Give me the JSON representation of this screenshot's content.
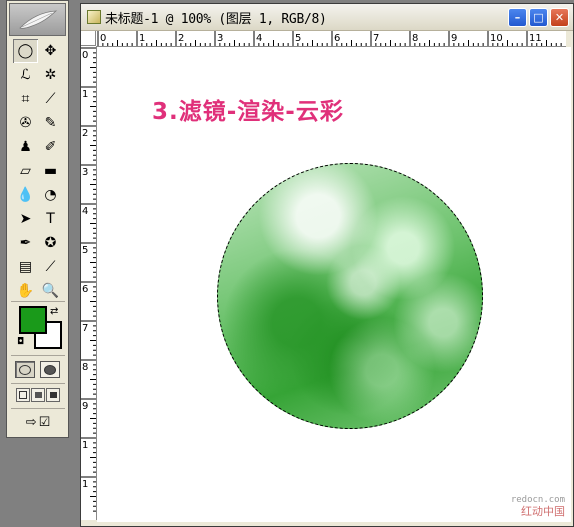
{
  "toolbox": {
    "tools": [
      {
        "name": "rectangular-marquee-tool-icon",
        "glyph": "◯",
        "selected": true
      },
      {
        "name": "move-tool-icon",
        "glyph": "✥"
      },
      {
        "name": "lasso-tool-icon",
        "glyph": "ℒ"
      },
      {
        "name": "magic-wand-tool-icon",
        "glyph": "✲"
      },
      {
        "name": "crop-tool-icon",
        "glyph": "⌗"
      },
      {
        "name": "slice-tool-icon",
        "glyph": "⟋"
      },
      {
        "name": "healing-brush-tool-icon",
        "glyph": "✇"
      },
      {
        "name": "brush-tool-icon",
        "glyph": "✎"
      },
      {
        "name": "clone-stamp-tool-icon",
        "glyph": "♟"
      },
      {
        "name": "history-brush-tool-icon",
        "glyph": "✐"
      },
      {
        "name": "eraser-tool-icon",
        "glyph": "▱"
      },
      {
        "name": "gradient-tool-icon",
        "glyph": "▬"
      },
      {
        "name": "blur-tool-icon",
        "glyph": "💧"
      },
      {
        "name": "dodge-tool-icon",
        "glyph": "◔"
      },
      {
        "name": "path-selection-tool-icon",
        "glyph": "➤"
      },
      {
        "name": "type-tool-icon",
        "glyph": "T"
      },
      {
        "name": "pen-tool-icon",
        "glyph": "✒"
      },
      {
        "name": "custom-shape-tool-icon",
        "glyph": "✪"
      },
      {
        "name": "notes-tool-icon",
        "glyph": "▤"
      },
      {
        "name": "eyedropper-tool-icon",
        "glyph": "⟋"
      },
      {
        "name": "hand-tool-icon",
        "glyph": "✋"
      },
      {
        "name": "zoom-tool-icon",
        "glyph": "🔍"
      }
    ],
    "foreground_color": "#1a9a1a",
    "background_color": "#ffffff"
  },
  "window": {
    "title": "未标题-1 @ 100% (图层 1, RGB/8)",
    "minimize": "–",
    "maximize": "□",
    "close": "✕"
  },
  "rulers": {
    "top_labels": [
      "0",
      "1",
      "2",
      "3",
      "4",
      "5",
      "6",
      "7",
      "8",
      "9",
      "10",
      "11"
    ],
    "left_labels": [
      "0",
      "1",
      "2",
      "3",
      "4",
      "5",
      "6",
      "7",
      "8",
      "9",
      "1",
      "1"
    ]
  },
  "canvas": {
    "caption": "3.滤镜-渲染-云彩",
    "circle_colors": {
      "light": "#bfe6bf",
      "mid": "#6cc26c",
      "dark": "#36a436"
    }
  },
  "watermark": {
    "url": "redocn.com",
    "name": "红动中国"
  }
}
